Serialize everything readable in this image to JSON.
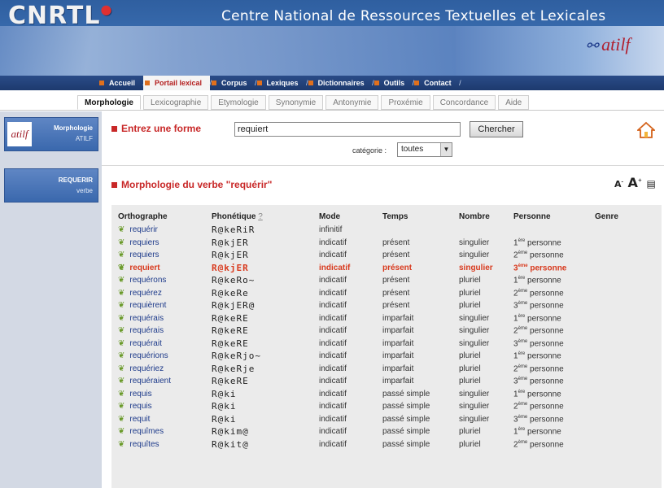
{
  "header": {
    "logo": "CNRTL",
    "site_title": "Centre National de Ressources Textuelles et Lexicales",
    "partner_logo": "atilf"
  },
  "main_nav": [
    "Accueil",
    "Portail lexical",
    "Corpus",
    "Lexiques",
    "Dictionnaires",
    "Outils",
    "Contact"
  ],
  "main_nav_active": "Portail lexical",
  "sub_nav": [
    "Morphologie",
    "Lexicographie",
    "Etymologie",
    "Synonymie",
    "Antonymie",
    "Proxémie",
    "Concordance",
    "Aide"
  ],
  "sub_nav_active": "Morphologie",
  "sidebar": {
    "card1": {
      "title": "Morphologie",
      "subtitle": "ATILF",
      "icon": "atilf-logo-icon"
    },
    "card2": {
      "title": "REQUERIR",
      "subtitle": "verbe"
    }
  },
  "form": {
    "label": "Entrez une forme",
    "value": "requiert",
    "button": "Chercher",
    "category_label": "catégorie :",
    "category_value": "toutes"
  },
  "section_title": "Morphologie du verbe \"requérir\"",
  "table": {
    "headers": {
      "ortho": "Orthographe",
      "phon": "Phonétique",
      "phon_help": "?",
      "mode": "Mode",
      "temps": "Temps",
      "nombre": "Nombre",
      "personne": "Personne",
      "genre": "Genre"
    },
    "rows": [
      {
        "ortho": "requérir",
        "phon": "R@keRiR",
        "mode": "infinitif",
        "temps": "",
        "nombre": "",
        "p_num": "",
        "p_sup": "",
        "p_txt": "",
        "hl": false
      },
      {
        "ortho": "requiers",
        "phon": "R@kjER",
        "mode": "indicatif",
        "temps": "présent",
        "nombre": "singulier",
        "p_num": "1",
        "p_sup": "ère",
        "p_txt": " personne",
        "hl": false
      },
      {
        "ortho": "requiers",
        "phon": "R@kjER",
        "mode": "indicatif",
        "temps": "présent",
        "nombre": "singulier",
        "p_num": "2",
        "p_sup": "ème",
        "p_txt": " personne",
        "hl": false
      },
      {
        "ortho": "requiert",
        "phon": "R@kjER",
        "mode": "indicatif",
        "temps": "présent",
        "nombre": "singulier",
        "p_num": "3",
        "p_sup": "ème",
        "p_txt": " personne",
        "hl": true
      },
      {
        "ortho": "requérons",
        "phon": "R@keRo~",
        "mode": "indicatif",
        "temps": "présent",
        "nombre": "pluriel",
        "p_num": "1",
        "p_sup": "ère",
        "p_txt": " personne",
        "hl": false
      },
      {
        "ortho": "requérez",
        "phon": "R@keRe",
        "mode": "indicatif",
        "temps": "présent",
        "nombre": "pluriel",
        "p_num": "2",
        "p_sup": "ème",
        "p_txt": " personne",
        "hl": false
      },
      {
        "ortho": "requièrent",
        "phon": "R@kjER@",
        "mode": "indicatif",
        "temps": "présent",
        "nombre": "pluriel",
        "p_num": "3",
        "p_sup": "ème",
        "p_txt": " personne",
        "hl": false
      },
      {
        "ortho": "requérais",
        "phon": "R@keRE",
        "mode": "indicatif",
        "temps": "imparfait",
        "nombre": "singulier",
        "p_num": "1",
        "p_sup": "ère",
        "p_txt": " personne",
        "hl": false
      },
      {
        "ortho": "requérais",
        "phon": "R@keRE",
        "mode": "indicatif",
        "temps": "imparfait",
        "nombre": "singulier",
        "p_num": "2",
        "p_sup": "ème",
        "p_txt": " personne",
        "hl": false
      },
      {
        "ortho": "requérait",
        "phon": "R@keRE",
        "mode": "indicatif",
        "temps": "imparfait",
        "nombre": "singulier",
        "p_num": "3",
        "p_sup": "ème",
        "p_txt": " personne",
        "hl": false
      },
      {
        "ortho": "requérions",
        "phon": "R@keRjo~",
        "mode": "indicatif",
        "temps": "imparfait",
        "nombre": "pluriel",
        "p_num": "1",
        "p_sup": "ère",
        "p_txt": " personne",
        "hl": false
      },
      {
        "ortho": "requériez",
        "phon": "R@keRje",
        "mode": "indicatif",
        "temps": "imparfait",
        "nombre": "pluriel",
        "p_num": "2",
        "p_sup": "ème",
        "p_txt": " personne",
        "hl": false
      },
      {
        "ortho": "requéraient",
        "phon": "R@keRE",
        "mode": "indicatif",
        "temps": "imparfait",
        "nombre": "pluriel",
        "p_num": "3",
        "p_sup": "ème",
        "p_txt": " personne",
        "hl": false
      },
      {
        "ortho": "requis",
        "phon": "R@ki",
        "mode": "indicatif",
        "temps": "passé simple",
        "nombre": "singulier",
        "p_num": "1",
        "p_sup": "ère",
        "p_txt": " personne",
        "hl": false
      },
      {
        "ortho": "requis",
        "phon": "R@ki",
        "mode": "indicatif",
        "temps": "passé simple",
        "nombre": "singulier",
        "p_num": "2",
        "p_sup": "ème",
        "p_txt": " personne",
        "hl": false
      },
      {
        "ortho": "requit",
        "phon": "R@ki",
        "mode": "indicatif",
        "temps": "passé simple",
        "nombre": "singulier",
        "p_num": "3",
        "p_sup": "ème",
        "p_txt": " personne",
        "hl": false
      },
      {
        "ortho": "requîmes",
        "phon": "R@kim@",
        "mode": "indicatif",
        "temps": "passé simple",
        "nombre": "pluriel",
        "p_num": "1",
        "p_sup": "ère",
        "p_txt": " personne",
        "hl": false
      },
      {
        "ortho": "requîtes",
        "phon": "R@kit@",
        "mode": "indicatif",
        "temps": "passé simple",
        "nombre": "pluriel",
        "p_num": "2",
        "p_sup": "ème",
        "p_txt": " personne",
        "hl": false
      }
    ]
  }
}
